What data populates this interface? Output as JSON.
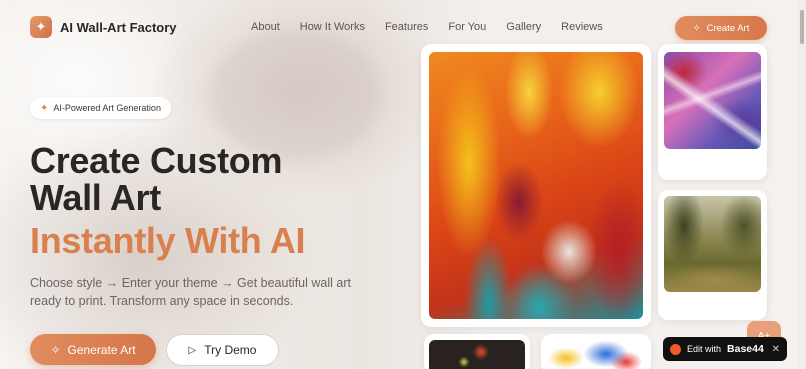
{
  "header": {
    "brand": "AI Wall-Art Factory",
    "nav": [
      "About",
      "How It Works",
      "Features",
      "For You",
      "Gallery",
      "Reviews"
    ],
    "cta": "Create Art"
  },
  "hero": {
    "badge": "AI-Powered Art Generation",
    "title_line1": "Create Custom",
    "title_line2": "Wall Art",
    "title_accent": "Instantly With AI",
    "subtitle_line1": "Choose style → Enter your theme → Get beautiful wall art",
    "subtitle_line2": "ready to print. Transform any space in seconds.",
    "primary_button": "Generate Art",
    "secondary_button": "Try Demo"
  },
  "floating": {
    "assist_label": "A+"
  },
  "toast": {
    "prefix": "Edit with",
    "brand": "Base44"
  },
  "colors": {
    "accent": "#d9804f",
    "text_dark": "#2a2624",
    "text_muted": "#6c6460"
  }
}
